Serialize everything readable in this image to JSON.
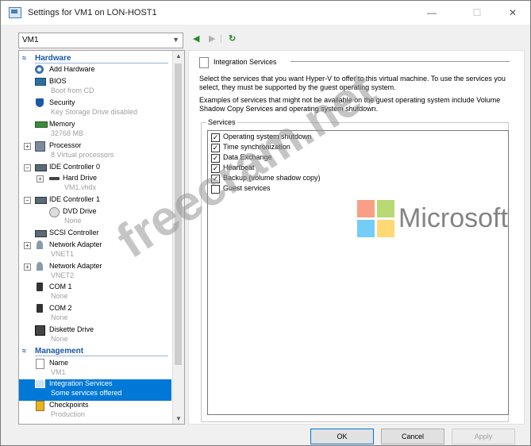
{
  "window": {
    "title": "Settings for VM1 on LON-HOST1",
    "minimize": "—",
    "maximize": "☐",
    "close": "✕"
  },
  "vm_selector": {
    "value": "VM1"
  },
  "left_pane": {
    "hardware_header": "Hardware",
    "management_header": "Management",
    "items": [
      {
        "label": "Add Hardware",
        "sub": ""
      },
      {
        "label": "BIOS",
        "sub": "Boot from CD"
      },
      {
        "label": "Security",
        "sub": "Key Storage Drive disabled"
      },
      {
        "label": "Memory",
        "sub": "32768 MB"
      },
      {
        "label": "Processor",
        "sub": "8 Virtual processors"
      },
      {
        "label": "IDE Controller 0",
        "sub": ""
      },
      {
        "label": "Hard Drive",
        "sub": "VM1.vhdx"
      },
      {
        "label": "IDE Controller 1",
        "sub": ""
      },
      {
        "label": "DVD Drive",
        "sub": "None"
      },
      {
        "label": "SCSI Controller",
        "sub": ""
      },
      {
        "label": "Network Adapter",
        "sub": "VNET1"
      },
      {
        "label": "Network Adapter",
        "sub": "VNET2"
      },
      {
        "label": "COM 1",
        "sub": "None"
      },
      {
        "label": "COM 2",
        "sub": "None"
      },
      {
        "label": "Diskette Drive",
        "sub": "None"
      },
      {
        "label": "Name",
        "sub": "VM1"
      },
      {
        "label": "Integration Services",
        "sub": "Some services offered"
      },
      {
        "label": "Checkpoints",
        "sub": "Production"
      }
    ]
  },
  "right_pane": {
    "title": "Integration Services",
    "description": "Select the services that you want Hyper-V to offer to this virtual machine. To use the services you select, they must be supported by the guest operating system.",
    "examples": "Examples of services that might not be available on the guest operating system include Volume Shadow Copy Services and operating system shutdown.",
    "services_label": "Services",
    "services": [
      {
        "label": "Operating system shutdown",
        "mark": "✓"
      },
      {
        "label": "Time synchronization",
        "mark": "✓"
      },
      {
        "label": "Data Exchange",
        "mark": "✓"
      },
      {
        "label": "Heartbeat",
        "mark": "✓"
      },
      {
        "label": "Backup (volume shadow copy)",
        "mark": "✓"
      },
      {
        "label": "Guest services",
        "mark": ""
      }
    ]
  },
  "buttons": {
    "ok": "OK",
    "cancel": "Cancel",
    "apply": "Apply"
  },
  "watermark": {
    "text": "freecram.net",
    "brand": "Microsoft"
  },
  "colors": {
    "accent": "#0078d7",
    "section_header": "#1c58a8",
    "nav_green": "#2c8a2c"
  }
}
